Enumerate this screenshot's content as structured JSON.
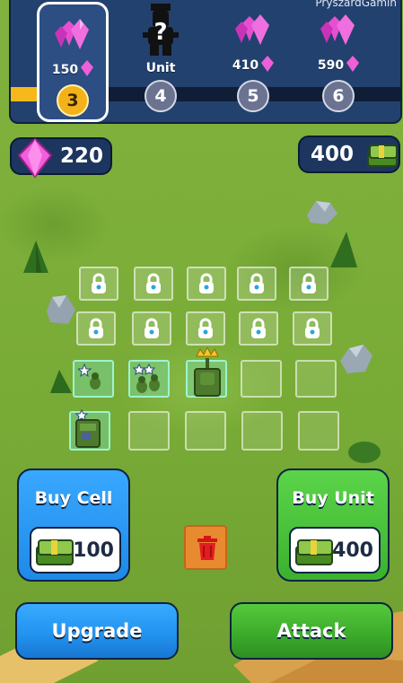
{
  "header": {
    "corner_text": "PryszardGamin",
    "progress_percent": 15,
    "tiers": [
      {
        "level": "3",
        "cost": "150",
        "state": "current"
      },
      {
        "level": "4",
        "label": "Unit",
        "state": "mystery"
      },
      {
        "level": "5",
        "cost": "410",
        "state": "locked"
      },
      {
        "level": "6",
        "cost": "590",
        "state": "locked"
      }
    ]
  },
  "currency": {
    "gems": "220",
    "cash": "400",
    "gem_icon": "pink-gem-icon",
    "cash_icon": "cash-stack-icon"
  },
  "board": {
    "rows": [
      [
        "locked",
        "locked",
        "locked",
        "locked",
        "locked"
      ],
      [
        "locked",
        "locked",
        "locked",
        "locked",
        "locked"
      ],
      [
        "unit",
        "unit",
        "unit",
        "empty",
        "empty"
      ],
      [
        "unit",
        "empty",
        "empty",
        "empty",
        "empty"
      ]
    ],
    "units": [
      {
        "kind": "soldier",
        "stars": 1
      },
      {
        "kind": "soldier-pair",
        "stars": 2
      },
      {
        "kind": "tank",
        "crown": true
      },
      {
        "kind": "truck",
        "stars": 1
      }
    ]
  },
  "actions": {
    "buy_cell_label": "Buy Cell",
    "buy_cell_price": "100",
    "buy_unit_label": "Buy Unit",
    "buy_unit_price": "400",
    "upgrade_label": "Upgrade",
    "attack_label": "Attack",
    "trash_icon": "trash-icon"
  },
  "colors": {
    "panel": "#23416e",
    "gold": "#f4b21a",
    "blue_button": "#2091ee",
    "green_button": "#3aa92a",
    "trash": "#e88a2f",
    "grass": "#7cae3a"
  }
}
